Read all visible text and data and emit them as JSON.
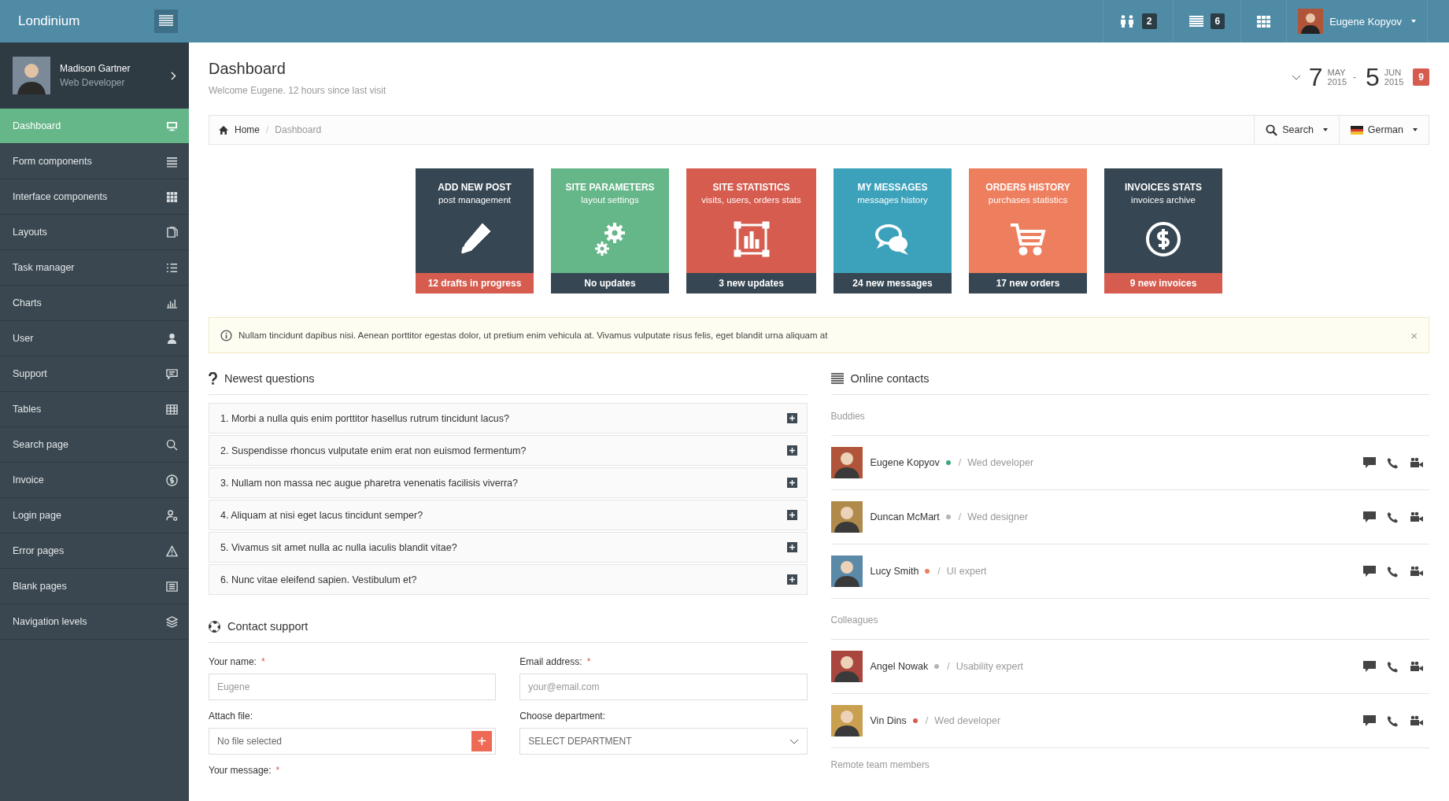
{
  "brand": "Londinium",
  "topbar": {
    "badges": [
      {
        "count": "2"
      },
      {
        "count": "6"
      }
    ],
    "user": "Eugene Kopyov"
  },
  "sidebar": {
    "profile": {
      "name": "Madison Gartner",
      "role": "Web Developer"
    },
    "items": [
      {
        "label": "Dashboard",
        "selected": true
      },
      {
        "label": "Form components",
        "selected": false
      },
      {
        "label": "Interface components",
        "selected": false
      },
      {
        "label": "Layouts",
        "selected": false
      },
      {
        "label": "Task manager",
        "selected": false
      },
      {
        "label": "Charts",
        "selected": false
      },
      {
        "label": "User",
        "selected": false
      },
      {
        "label": "Support",
        "selected": false
      },
      {
        "label": "Tables",
        "selected": false
      },
      {
        "label": "Search page",
        "selected": false
      },
      {
        "label": "Invoice",
        "selected": false
      },
      {
        "label": "Login page",
        "selected": false
      },
      {
        "label": "Error pages",
        "selected": false
      },
      {
        "label": "Blank pages",
        "selected": false
      },
      {
        "label": "Navigation levels",
        "selected": false
      }
    ]
  },
  "page": {
    "title": "Dashboard",
    "subtitle": "Welcome Eugene. 12 hours since last visit"
  },
  "date_range": {
    "from": {
      "day": "7",
      "month": "MAY",
      "year": "2015"
    },
    "separator": "-",
    "to": {
      "day": "5",
      "month": "JUN",
      "year": "2015"
    },
    "badge": "9"
  },
  "breadcrumb": {
    "items": [
      "Home",
      "Dashboard"
    ],
    "separator": "/",
    "search": "Search",
    "language": "German"
  },
  "tiles": [
    {
      "title": "ADD NEW POST",
      "subtitle": "post management",
      "footer": "12 drafts in progress",
      "color": "#364652",
      "highlighted": true
    },
    {
      "title": "SITE PARAMETERS",
      "subtitle": "layout settings",
      "footer": "No updates",
      "color": "#65b688",
      "highlighted": false
    },
    {
      "title": "SITE STATISTICS",
      "subtitle": "visits, users, orders stats",
      "footer": "3 new updates",
      "color": "#d65c4f",
      "highlighted": false
    },
    {
      "title": "MY MESSAGES",
      "subtitle": "messages history",
      "footer": "24 new messages",
      "color": "#3ca2bb",
      "highlighted": false
    },
    {
      "title": "ORDERS HISTORY",
      "subtitle": "purchases statistics",
      "footer": "17 new orders",
      "color": "#ee7f5e",
      "highlighted": false
    },
    {
      "title": "INVOICES STATS",
      "subtitle": "invoices archive",
      "footer": "9 new invoices",
      "color": "#364652",
      "highlighted": true
    }
  ],
  "alert": {
    "text": "Nullam tincidunt dapibus nisi. Aenean porttitor egestas dolor, ut pretium enim vehicula at. Vivamus vulputate risus felis, eget blandit urna aliquam at",
    "close": "×"
  },
  "questions": {
    "title": "Newest questions",
    "items": [
      "1. Morbi a nulla quis enim porttitor hasellus rutrum tincidunt lacus?",
      "2. Suspendisse rhoncus vulputate enim erat non euismod fermentum?",
      "3. Nullam non massa nec augue pharetra venenatis facilisis viverra?",
      "4. Aliquam at nisi eget lacus tincidunt semper?",
      "5. Vivamus sit amet nulla ac nulla iaculis blandit vitae?",
      "6. Nunc vitae eleifend sapien. Vestibulum et?"
    ]
  },
  "support": {
    "title": "Contact support",
    "required_mark": "*",
    "name": {
      "label": "Your name:",
      "placeholder": "Eugene"
    },
    "email": {
      "label": "Email address:",
      "placeholder": "your@email.com"
    },
    "file": {
      "label": "Attach file:",
      "value": "No file selected",
      "button": "+"
    },
    "department": {
      "label": "Choose department:",
      "value": "SELECT DEPARTMENT"
    },
    "message": {
      "label": "Your message:"
    }
  },
  "contacts": {
    "title": "Online contacts",
    "groups": [
      {
        "label": "Buddies",
        "people": [
          {
            "name": "Eugene Kopyov",
            "color": "#3ca77a",
            "separator": "/",
            "role": "Wed developer"
          },
          {
            "name": "Duncan McMart",
            "color": "#b5b5b5",
            "separator": "/",
            "role": "Wed designer"
          },
          {
            "name": "Lucy Smith",
            "color": "#ee7f5e",
            "separator": "/",
            "role": "UI expert"
          }
        ]
      },
      {
        "label": "Colleagues",
        "people": [
          {
            "name": "Angel Nowak",
            "color": "#b5b5b5",
            "separator": "/",
            "role": "Usability expert"
          },
          {
            "name": "Vin Dins",
            "color": "#d65c4f",
            "separator": "/",
            "role": "Wed developer"
          }
        ]
      },
      {
        "label": "Remote team members"
      }
    ]
  }
}
